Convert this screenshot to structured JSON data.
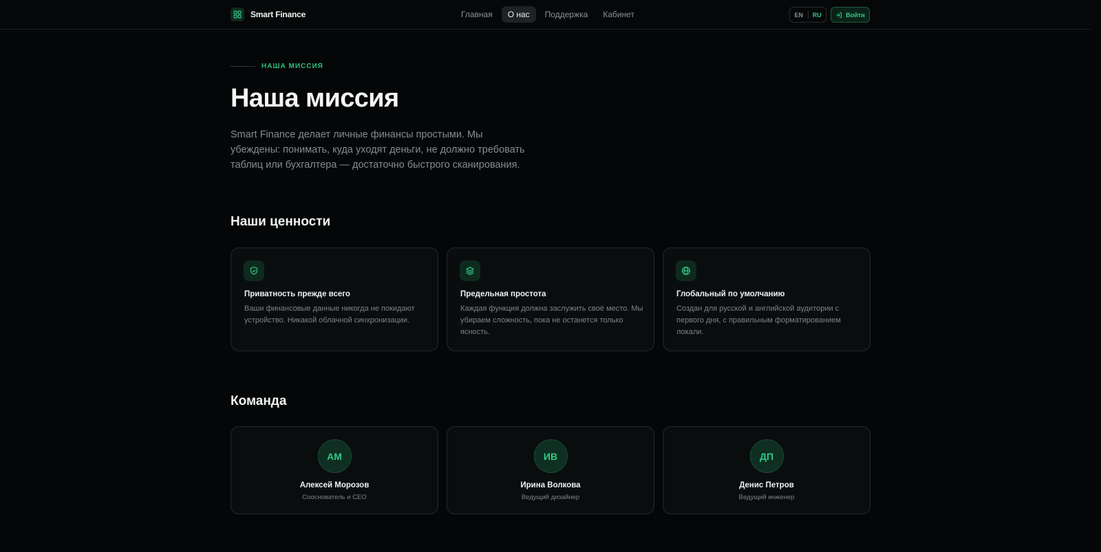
{
  "header": {
    "brand": "Smart Finance",
    "nav": [
      {
        "label": "Главная",
        "active": false
      },
      {
        "label": "О нас",
        "active": true
      },
      {
        "label": "Поддержка",
        "active": false
      },
      {
        "label": "Кабинет",
        "active": false
      }
    ],
    "lang": {
      "en": "EN",
      "ru": "RU",
      "selected": "RU"
    },
    "login_label": "Войти"
  },
  "hero": {
    "eyebrow": "НАША МИССИЯ",
    "title": "Наша миссия",
    "description": "Smart Finance делает личные финансы простыми. Мы убеждены: понимать, куда уходят деньги, не должно требовать таблиц или бухгалтера — достаточно быстрого сканирования."
  },
  "values": {
    "title": "Наши ценности",
    "items": [
      {
        "icon": "shield-icon",
        "title": "Приватность прежде всего",
        "description": "Ваши финансовые данные никогда не покидают устройство. Никакой облачной синхронизации."
      },
      {
        "icon": "layers-icon",
        "title": "Предельная простота",
        "description": "Каждая функция должна заслужить своё место. Мы убираем сложность, пока не останется только ясность."
      },
      {
        "icon": "globe-icon",
        "title": "Глобальный по умолчанию",
        "description": "Создан для русской и английской аудитории с первого дня, с правильным форматированием локали."
      }
    ]
  },
  "team": {
    "title": "Команда",
    "members": [
      {
        "initials": "АМ",
        "name": "Алексей Морозов",
        "role": "Сооснователь и CEO"
      },
      {
        "initials": "ИВ",
        "name": "Ирина Волкова",
        "role": "Ведущий дизайнер"
      },
      {
        "initials": "ДП",
        "name": "Денис Петров",
        "role": "Ведущий инженер"
      }
    ]
  },
  "colors": {
    "accent": "#33c884",
    "background": "#050607",
    "card": "#0a0d0e"
  }
}
